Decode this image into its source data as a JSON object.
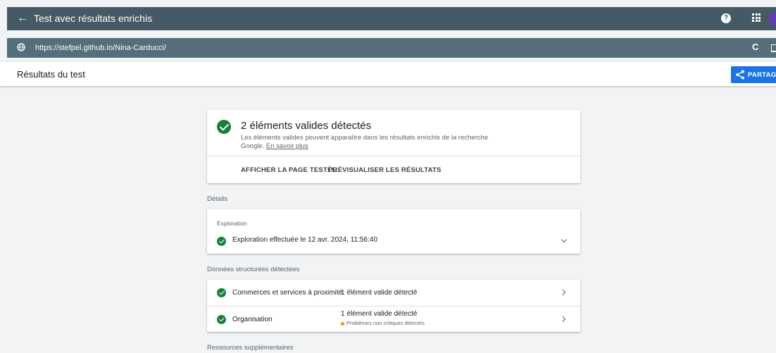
{
  "appbar": {
    "back_icon": "arrow-left-icon",
    "title": "Test avec résultats enrichis",
    "help_label": "?"
  },
  "urlbar": {
    "url": "https://stefpel.github.io/Nina-Carducci/",
    "reload_glyph": "C"
  },
  "subheader": {
    "title": "Résultats du test",
    "share_label": "PARTAGER"
  },
  "summary": {
    "heading": "2 éléments valides détectés",
    "description": "Les éléments valides peuvent apparaître dans les résultats enrichis de la recherche Google.",
    "learn_more": "En savoir plus",
    "actions": [
      "AFFICHER LA PAGE TESTÉE",
      "PRÉVISUALISER LES RÉSULTATS"
    ]
  },
  "details": {
    "section_label": "Détails",
    "crawl_label": "Exploration",
    "crawl_text": "Exploration effectuée le 12 avr. 2024, 11:56:40"
  },
  "structured_data": {
    "section_label": "Données structurées détectées",
    "rows": [
      {
        "name": "Commerces et services à proximité",
        "value": "1 élément valide détecté",
        "note": ""
      },
      {
        "name": "Organisation",
        "value": "1 élément valide détecté",
        "note": "Problèmes non critiques détectés"
      }
    ]
  },
  "resources": {
    "section_label": "Ressources supplémentaires"
  },
  "colors": {
    "appbar": "#455a64",
    "urlbar": "#546e7a",
    "accent": "#1a73e8",
    "valid": "#188038",
    "warning": "#f29900"
  }
}
